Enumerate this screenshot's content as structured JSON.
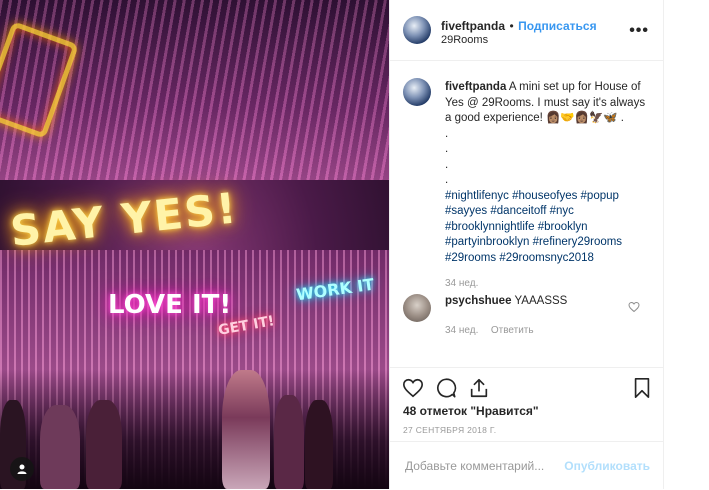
{
  "post": {
    "author": "fiveftpanda",
    "follow_label": "Подписаться",
    "separator": "•",
    "location": "29Rooms",
    "more_label": "•••"
  },
  "image": {
    "neon_say_yes": "SAY YES!",
    "neon_love_it": "LOVE IT!",
    "neon_get_it": "GET IT!",
    "neon_work_it": "WORK IT"
  },
  "caption": {
    "author": "fiveftpanda",
    "text": " A mini set up for House of Yes @ 29Rooms. I must say it's always a good experience! 👩🏽‍🤝‍👩🏽🦅🦋 .",
    "dots": [
      ".",
      ".",
      ".",
      "."
    ],
    "hashtags": "#nightlifenyc #houseofyes #popup #sayyes #danceitoff #nyc #brooklynnightlife #brooklyn #partyinbrooklyn #refinery29rooms #29rooms #29roomsnyc2018",
    "time": "34 нед."
  },
  "comments": [
    {
      "author": "psychshuee",
      "text": "YAAASSS",
      "time": "34 нед.",
      "reply_label": "Ответить"
    }
  ],
  "actions": {
    "likes": "48 отметок \"Нравится\"",
    "date": "27 СЕНТЯБРЯ 2018 Г."
  },
  "add_comment": {
    "placeholder": "Добавьте комментарий...",
    "publish_label": "Опубликовать"
  },
  "colors": {
    "link_blue": "#3897f0",
    "hashtag_blue": "#003569",
    "muted_gray": "#999999",
    "publish_disabled": "#b2dffc"
  }
}
